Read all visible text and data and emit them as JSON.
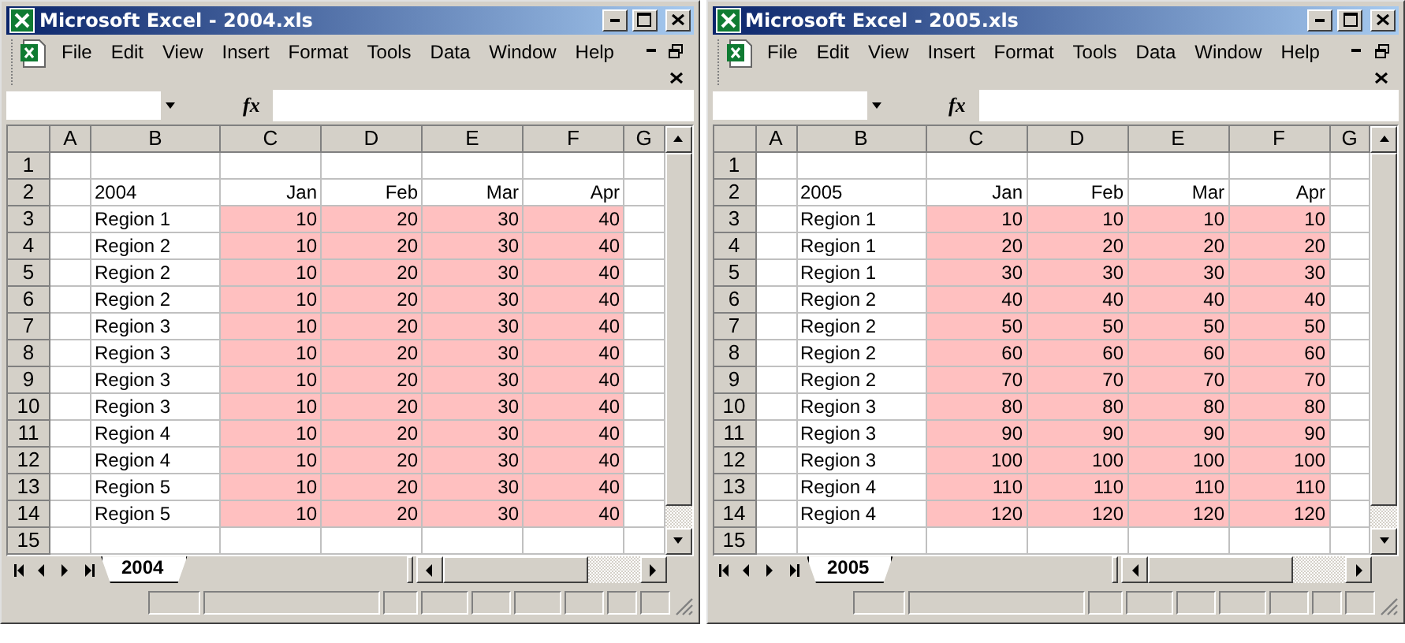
{
  "windows": [
    {
      "title": "Microsoft Excel - 2004.xls",
      "menu": [
        "File",
        "Edit",
        "View",
        "Insert",
        "Format",
        "Tools",
        "Data",
        "Window",
        "Help"
      ],
      "formula_label": "fx",
      "columns": [
        "A",
        "B",
        "C",
        "D",
        "E",
        "F",
        "G"
      ],
      "rows": [
        {
          "number": "1"
        },
        {
          "number": "2",
          "label": "2004",
          "values": [
            "Jan",
            "Feb",
            "Mar",
            "Apr"
          ],
          "highlighted": false
        },
        {
          "number": "3",
          "label": "Region 1",
          "values": [
            "10",
            "20",
            "30",
            "40"
          ],
          "highlighted": true
        },
        {
          "number": "4",
          "label": "Region 2",
          "values": [
            "10",
            "20",
            "30",
            "40"
          ],
          "highlighted": true
        },
        {
          "number": "5",
          "label": "Region 2",
          "values": [
            "10",
            "20",
            "30",
            "40"
          ],
          "highlighted": true
        },
        {
          "number": "6",
          "label": "Region 2",
          "values": [
            "10",
            "20",
            "30",
            "40"
          ],
          "highlighted": true
        },
        {
          "number": "7",
          "label": "Region 3",
          "values": [
            "10",
            "20",
            "30",
            "40"
          ],
          "highlighted": true
        },
        {
          "number": "8",
          "label": "Region 3",
          "values": [
            "10",
            "20",
            "30",
            "40"
          ],
          "highlighted": true
        },
        {
          "number": "9",
          "label": "Region 3",
          "values": [
            "10",
            "20",
            "30",
            "40"
          ],
          "highlighted": true
        },
        {
          "number": "10",
          "label": "Region 3",
          "values": [
            "10",
            "20",
            "30",
            "40"
          ],
          "highlighted": true
        },
        {
          "number": "11",
          "label": "Region 4",
          "values": [
            "10",
            "20",
            "30",
            "40"
          ],
          "highlighted": true
        },
        {
          "number": "12",
          "label": "Region 4",
          "values": [
            "10",
            "20",
            "30",
            "40"
          ],
          "highlighted": true
        },
        {
          "number": "13",
          "label": "Region 5",
          "values": [
            "10",
            "20",
            "30",
            "40"
          ],
          "highlighted": true
        },
        {
          "number": "14",
          "label": "Region 5",
          "values": [
            "10",
            "20",
            "30",
            "40"
          ],
          "highlighted": true
        },
        {
          "number": "15"
        }
      ],
      "sheet_tabs": [
        {
          "label": "2004",
          "selected": true
        }
      ]
    },
    {
      "title": "Microsoft Excel - 2005.xls",
      "menu": [
        "File",
        "Edit",
        "View",
        "Insert",
        "Format",
        "Tools",
        "Data",
        "Window",
        "Help"
      ],
      "formula_label": "fx",
      "columns": [
        "A",
        "B",
        "C",
        "D",
        "E",
        "F",
        "G"
      ],
      "rows": [
        {
          "number": "1"
        },
        {
          "number": "2",
          "label": "2005",
          "values": [
            "Jan",
            "Feb",
            "Mar",
            "Apr"
          ],
          "highlighted": false
        },
        {
          "number": "3",
          "label": "Region 1",
          "values": [
            "10",
            "10",
            "10",
            "10"
          ],
          "highlighted": true
        },
        {
          "number": "4",
          "label": "Region 1",
          "values": [
            "20",
            "20",
            "20",
            "20"
          ],
          "highlighted": true
        },
        {
          "number": "5",
          "label": "Region 1",
          "values": [
            "30",
            "30",
            "30",
            "30"
          ],
          "highlighted": true
        },
        {
          "number": "6",
          "label": "Region 2",
          "values": [
            "40",
            "40",
            "40",
            "40"
          ],
          "highlighted": true
        },
        {
          "number": "7",
          "label": "Region 2",
          "values": [
            "50",
            "50",
            "50",
            "50"
          ],
          "highlighted": true
        },
        {
          "number": "8",
          "label": "Region 2",
          "values": [
            "60",
            "60",
            "60",
            "60"
          ],
          "highlighted": true
        },
        {
          "number": "9",
          "label": "Region 2",
          "values": [
            "70",
            "70",
            "70",
            "70"
          ],
          "highlighted": true
        },
        {
          "number": "10",
          "label": "Region 3",
          "values": [
            "80",
            "80",
            "80",
            "80"
          ],
          "highlighted": true
        },
        {
          "number": "11",
          "label": "Region 3",
          "values": [
            "90",
            "90",
            "90",
            "90"
          ],
          "highlighted": true
        },
        {
          "number": "12",
          "label": "Region 3",
          "values": [
            "100",
            "100",
            "100",
            "100"
          ],
          "highlighted": true
        },
        {
          "number": "13",
          "label": "Region 4",
          "values": [
            "110",
            "110",
            "110",
            "110"
          ],
          "highlighted": true
        },
        {
          "number": "14",
          "label": "Region 4",
          "values": [
            "120",
            "120",
            "120",
            "120"
          ],
          "highlighted": true
        },
        {
          "number": "15"
        }
      ],
      "sheet_tabs": [
        {
          "label": "2005",
          "selected": true
        }
      ]
    }
  ]
}
